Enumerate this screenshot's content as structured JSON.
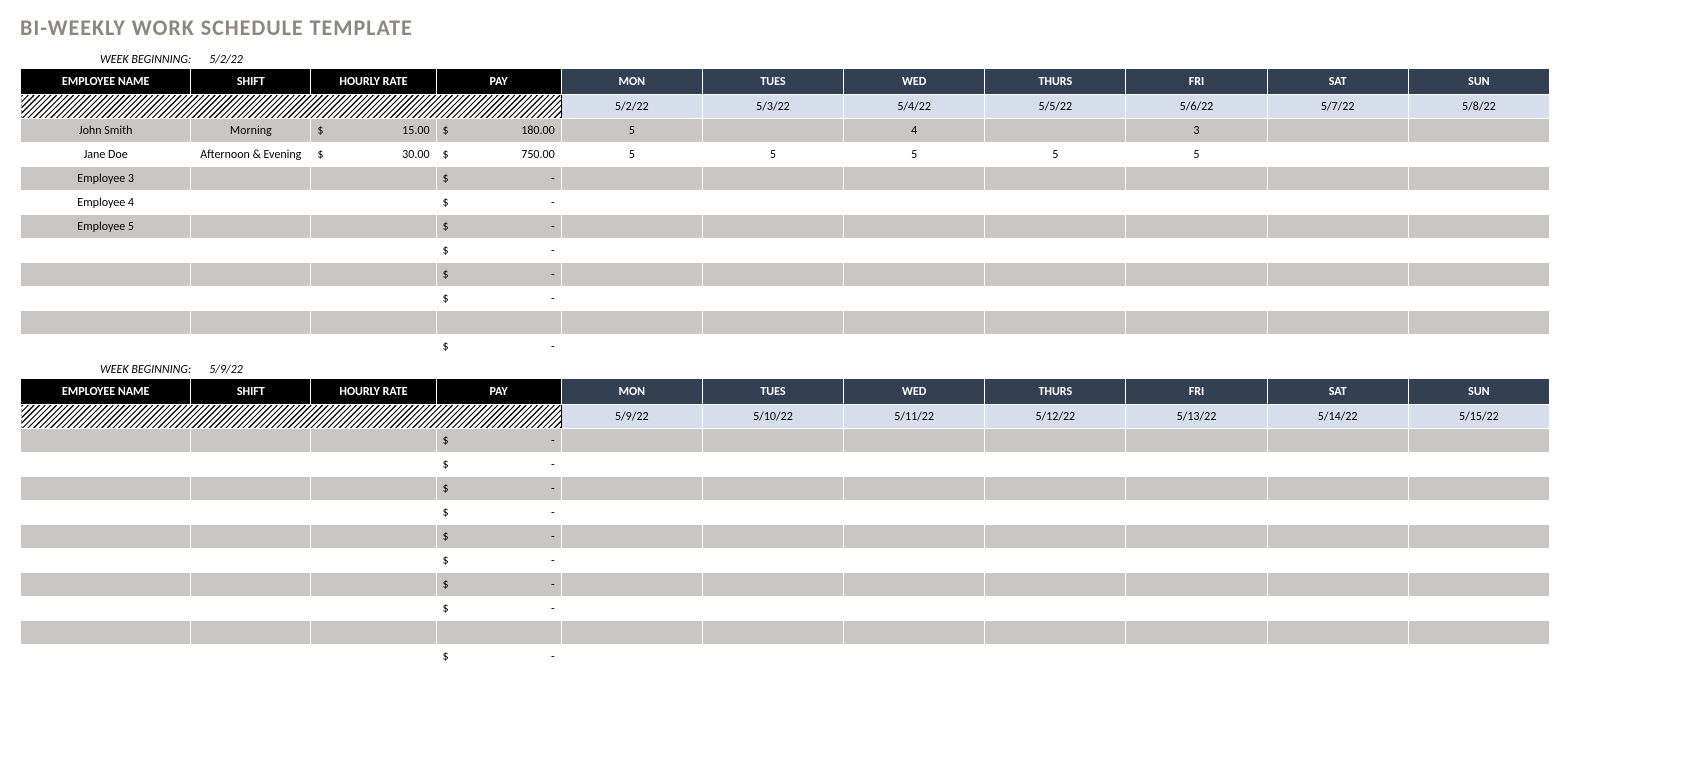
{
  "title": "BI-WEEKLY WORK SCHEDULE TEMPLATE",
  "week_begin_label": "WEEK BEGINNING:",
  "headers": {
    "name": "EMPLOYEE NAME",
    "shift": "SHIFT",
    "rate": "HOURLY RATE",
    "pay": "PAY",
    "days": [
      "MON",
      "TUES",
      "WED",
      "THURS",
      "FRI",
      "SAT",
      "SUN"
    ]
  },
  "weeks": [
    {
      "begin_date": "5/2/22",
      "dates": [
        "5/2/22",
        "5/3/22",
        "5/4/22",
        "5/5/22",
        "5/6/22",
        "5/7/22",
        "5/8/22"
      ],
      "rows": [
        {
          "name": "John Smith",
          "shift": "Morning",
          "rate": "15.00",
          "pay": "180.00",
          "hours": [
            "5",
            "",
            "4",
            "",
            "3",
            "",
            ""
          ]
        },
        {
          "name": "Jane Doe",
          "shift": "Afternoon & Evening",
          "rate": "30.00",
          "pay": "750.00",
          "hours": [
            "5",
            "5",
            "5",
            "5",
            "5",
            "",
            ""
          ]
        },
        {
          "name": "Employee 3",
          "shift": "",
          "rate": "",
          "pay": "-",
          "hours": [
            "",
            "",
            "",
            "",
            "",
            "",
            ""
          ]
        },
        {
          "name": "Employee 4",
          "shift": "",
          "rate": "",
          "pay": "-",
          "hours": [
            "",
            "",
            "",
            "",
            "",
            "",
            ""
          ]
        },
        {
          "name": "Employee 5",
          "shift": "",
          "rate": "",
          "pay": "-",
          "hours": [
            "",
            "",
            "",
            "",
            "",
            "",
            ""
          ]
        },
        {
          "name": "",
          "shift": "",
          "rate": "",
          "pay": "-",
          "hours": [
            "",
            "",
            "",
            "",
            "",
            "",
            ""
          ]
        },
        {
          "name": "",
          "shift": "",
          "rate": "",
          "pay": "-",
          "hours": [
            "",
            "",
            "",
            "",
            "",
            "",
            ""
          ]
        },
        {
          "name": "",
          "shift": "",
          "rate": "",
          "pay": "-",
          "hours": [
            "",
            "",
            "",
            "",
            "",
            "",
            ""
          ]
        },
        {
          "name": "",
          "shift": "",
          "rate": "",
          "pay": "",
          "hours": [
            "",
            "",
            "",
            "",
            "",
            "",
            ""
          ],
          "no_pay_dollar": true
        },
        {
          "name": "",
          "shift": "",
          "rate": "",
          "pay": "-",
          "hours": [
            "",
            "",
            "",
            "",
            "",
            "",
            ""
          ]
        }
      ]
    },
    {
      "begin_date": "5/9/22",
      "dates": [
        "5/9/22",
        "5/10/22",
        "5/11/22",
        "5/12/22",
        "5/13/22",
        "5/14/22",
        "5/15/22"
      ],
      "rows": [
        {
          "name": "",
          "shift": "",
          "rate": "",
          "pay": "-",
          "hours": [
            "",
            "",
            "",
            "",
            "",
            "",
            ""
          ]
        },
        {
          "name": "",
          "shift": "",
          "rate": "",
          "pay": "-",
          "hours": [
            "",
            "",
            "",
            "",
            "",
            "",
            ""
          ]
        },
        {
          "name": "",
          "shift": "",
          "rate": "",
          "pay": "-",
          "hours": [
            "",
            "",
            "",
            "",
            "",
            "",
            ""
          ]
        },
        {
          "name": "",
          "shift": "",
          "rate": "",
          "pay": "-",
          "hours": [
            "",
            "",
            "",
            "",
            "",
            "",
            ""
          ]
        },
        {
          "name": "",
          "shift": "",
          "rate": "",
          "pay": "-",
          "hours": [
            "",
            "",
            "",
            "",
            "",
            "",
            ""
          ]
        },
        {
          "name": "",
          "shift": "",
          "rate": "",
          "pay": "-",
          "hours": [
            "",
            "",
            "",
            "",
            "",
            "",
            ""
          ]
        },
        {
          "name": "",
          "shift": "",
          "rate": "",
          "pay": "-",
          "hours": [
            "",
            "",
            "",
            "",
            "",
            "",
            ""
          ]
        },
        {
          "name": "",
          "shift": "",
          "rate": "",
          "pay": "-",
          "hours": [
            "",
            "",
            "",
            "",
            "",
            "",
            ""
          ]
        },
        {
          "name": "",
          "shift": "",
          "rate": "",
          "pay": "",
          "hours": [
            "",
            "",
            "",
            "",
            "",
            "",
            ""
          ],
          "no_pay_dollar": true
        },
        {
          "name": "",
          "shift": "",
          "rate": "",
          "pay": "-",
          "hours": [
            "",
            "",
            "",
            "",
            "",
            "",
            ""
          ]
        }
      ]
    }
  ]
}
